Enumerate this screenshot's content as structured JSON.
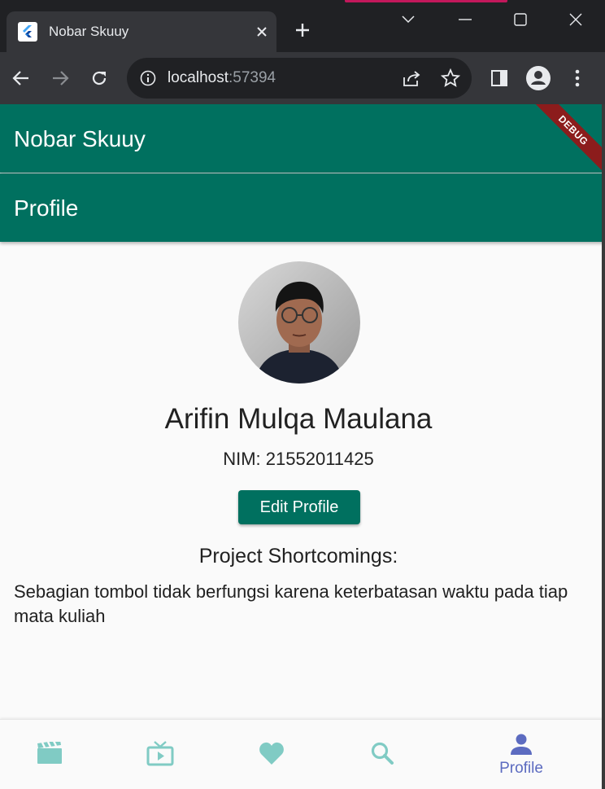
{
  "browser": {
    "tab_title": "Nobar Skuuy",
    "url_host": "localhost",
    "url_port": ":57394",
    "icons": [
      "flutter-favicon",
      "close-icon",
      "plus-icon",
      "chevron-down-icon",
      "minimize-icon",
      "maximize-icon",
      "window-close-icon",
      "back-icon",
      "forward-icon",
      "reload-icon",
      "info-icon",
      "share-icon",
      "star-icon",
      "side-panel-icon",
      "profile-icon",
      "kebab-menu-icon"
    ]
  },
  "app": {
    "title": "Nobar Skuuy",
    "page_title": "Profile",
    "debug_banner": "DEBUG",
    "accent_color": "#00705f"
  },
  "profile": {
    "name": "Arifin Mulqa Maulana",
    "nim": "NIM: 21552011425",
    "edit_button": "Edit Profile",
    "shortcomings_title": "Project Shortcomings:",
    "shortcomings_text": "Sebagian tombol tidak berfungsi karena keterbatasan waktu pada tiap mata kuliah"
  },
  "bottom_nav": {
    "items": [
      {
        "icon": "movie-icon",
        "label": ""
      },
      {
        "icon": "tv-icon",
        "label": ""
      },
      {
        "icon": "heart-icon",
        "label": ""
      },
      {
        "icon": "search-icon",
        "label": ""
      },
      {
        "icon": "person-icon",
        "label": "Profile",
        "selected": true
      }
    ],
    "inactive_color": "#80cbc4",
    "active_color": "#5c6bc0"
  }
}
